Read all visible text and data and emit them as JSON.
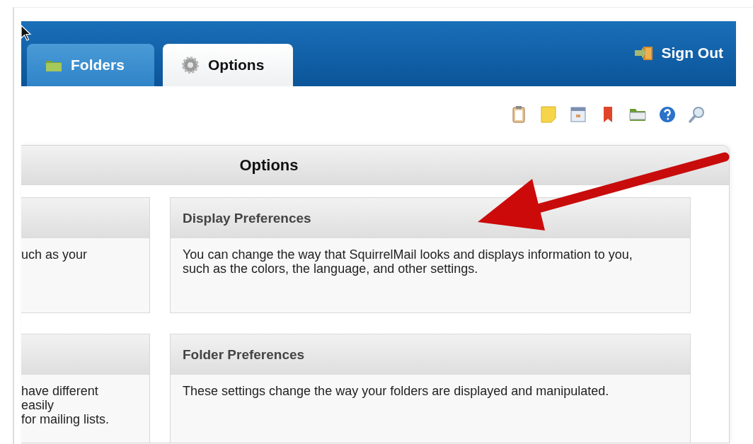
{
  "tabs": [
    {
      "label": "Folders",
      "selected": false
    },
    {
      "label": "Options",
      "selected": true
    }
  ],
  "sign_out": "Sign Out",
  "panel": {
    "title": "Options"
  },
  "left_column": [
    {
      "lines": [
        "uch as your"
      ]
    },
    {
      "lines": [
        "have different",
        "easily",
        "for mailing lists."
      ]
    }
  ],
  "right_column": [
    {
      "title": "Display Preferences",
      "description": "You can change the way that SquirrelMail looks and displays information to you, such as the colors, the language, and other settings."
    },
    {
      "title": "Folder Preferences",
      "description": "These settings change the way your folders are displayed and manipulated."
    }
  ]
}
